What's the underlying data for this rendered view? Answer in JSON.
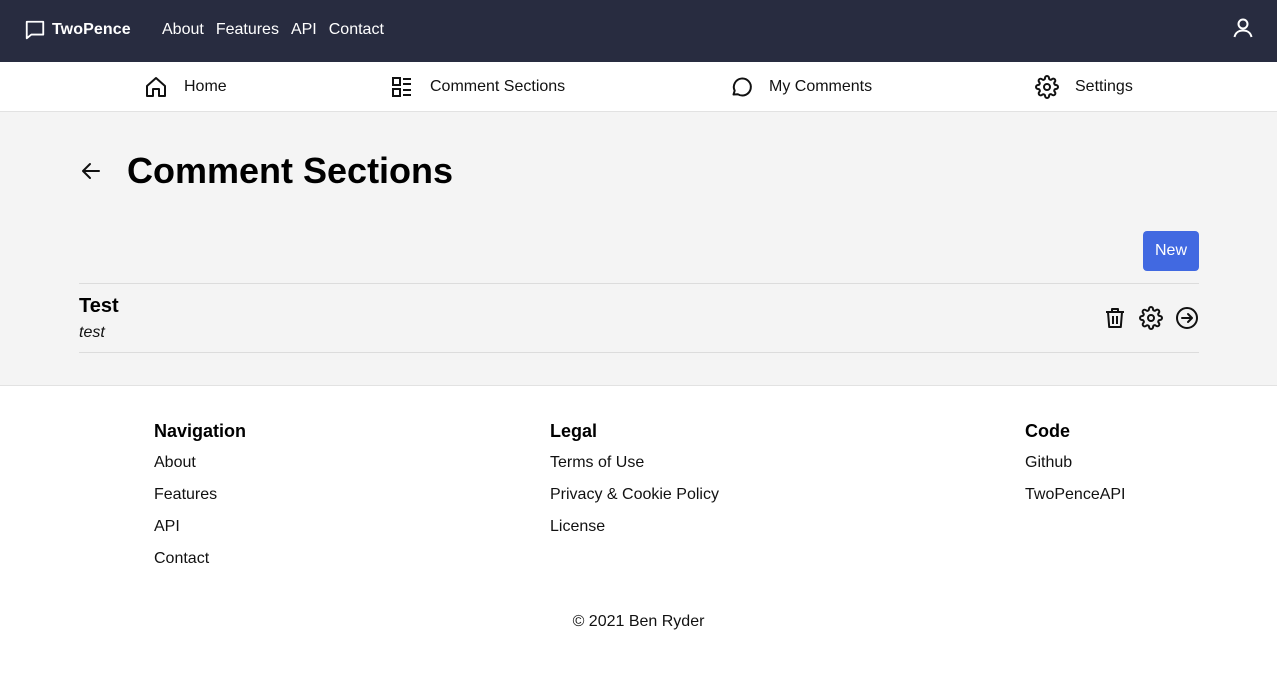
{
  "topbar": {
    "brand": "TwoPence",
    "nav": [
      "About",
      "Features",
      "API",
      "Contact"
    ]
  },
  "subnav": {
    "items": [
      {
        "label": "Home",
        "icon": "home-icon"
      },
      {
        "label": "Comment Sections",
        "icon": "list-icon"
      },
      {
        "label": "My Comments",
        "icon": "comment-icon"
      },
      {
        "label": "Settings",
        "icon": "gear-icon"
      }
    ]
  },
  "main": {
    "title": "Comment Sections",
    "new_label": "New",
    "sections": [
      {
        "title": "Test",
        "description": "test"
      }
    ]
  },
  "footer": {
    "columns": [
      {
        "heading": "Navigation",
        "links": [
          "About",
          "Features",
          "API",
          "Contact"
        ]
      },
      {
        "heading": "Legal",
        "links": [
          "Terms of Use",
          "Privacy & Cookie Policy",
          "License"
        ]
      },
      {
        "heading": "Code",
        "links": [
          "Github",
          "TwoPenceAPI"
        ]
      }
    ],
    "copyright": "© 2021 Ben Ryder"
  },
  "colors": {
    "topbar_bg": "#282c40",
    "primary": "#4169e1",
    "main_bg": "#f4f4f4"
  }
}
